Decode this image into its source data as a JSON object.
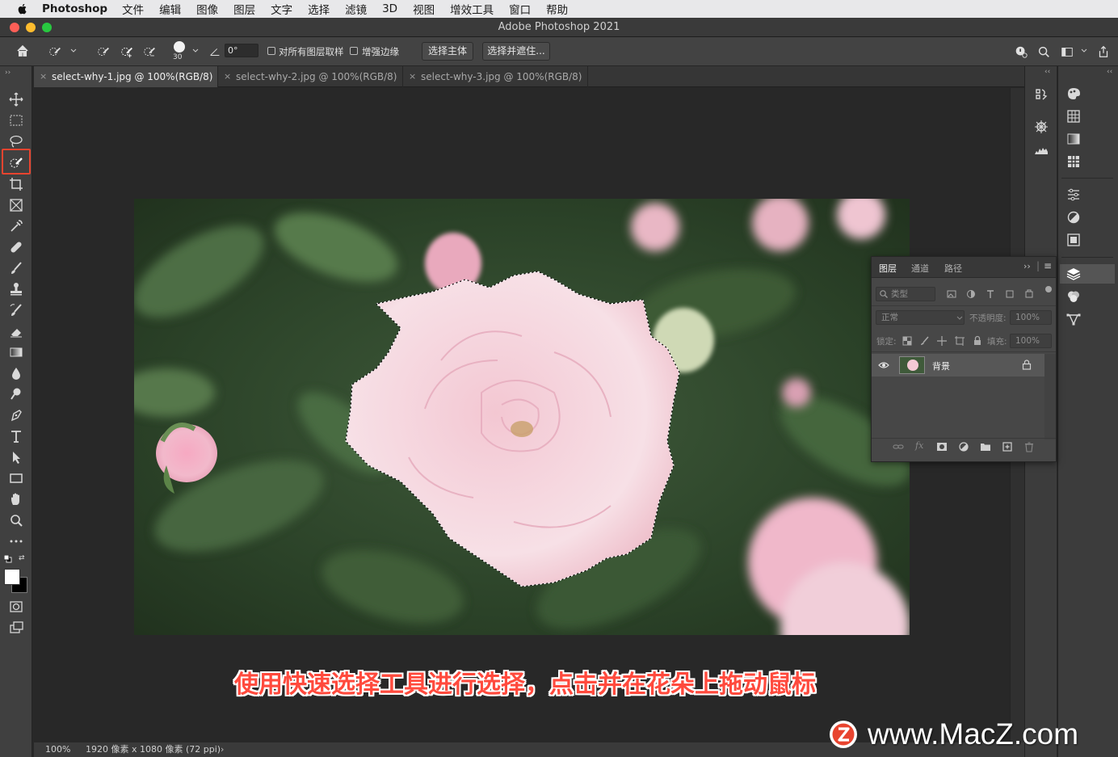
{
  "menubar": {
    "app_name": "Photoshop",
    "items": [
      "文件",
      "编辑",
      "图像",
      "图层",
      "文字",
      "选择",
      "滤镜",
      "3D",
      "视图",
      "增效工具",
      "窗口",
      "帮助"
    ]
  },
  "window": {
    "title": "Adobe Photoshop 2021"
  },
  "options": {
    "brush_size": "30",
    "angle": "0°",
    "sample_all_layers_label": "对所有图层取样",
    "enhance_edge_label": "增强边缘",
    "select_subject_label": "选择主体",
    "select_and_mask_label": "选择并遮住..."
  },
  "tabs": [
    {
      "label": "select-why-1.jpg @ 100%(RGB/8)",
      "active": true
    },
    {
      "label": "select-why-2.jpg @ 100%(RGB/8)",
      "active": false
    },
    {
      "label": "select-why-3.jpg @ 100%(RGB/8)",
      "active": false
    }
  ],
  "status": {
    "zoom": "100%",
    "doc_info": "1920 像素 x 1080 像素 (72 ppi)"
  },
  "layers_panel": {
    "tabs": [
      "图层",
      "通道",
      "路径"
    ],
    "filter_placeholder": "类型",
    "blend_mode": "正常",
    "opacity_label": "不透明度:",
    "opacity_value": "100%",
    "lock_label": "锁定:",
    "fill_label": "填充:",
    "fill_value": "100%",
    "layers": [
      {
        "name": "背景",
        "locked": true,
        "visible": true
      }
    ]
  },
  "caption": "使用快速选择工具进行选择，点击并在花朵上拖动鼠标",
  "watermark": "www.MacZ.com",
  "colors": {
    "highlight_box": "#e8442f",
    "caption_text": "#ff4a3d",
    "traffic_red": "#fe5f57",
    "traffic_yellow": "#febc2e",
    "traffic_green": "#28c840"
  }
}
